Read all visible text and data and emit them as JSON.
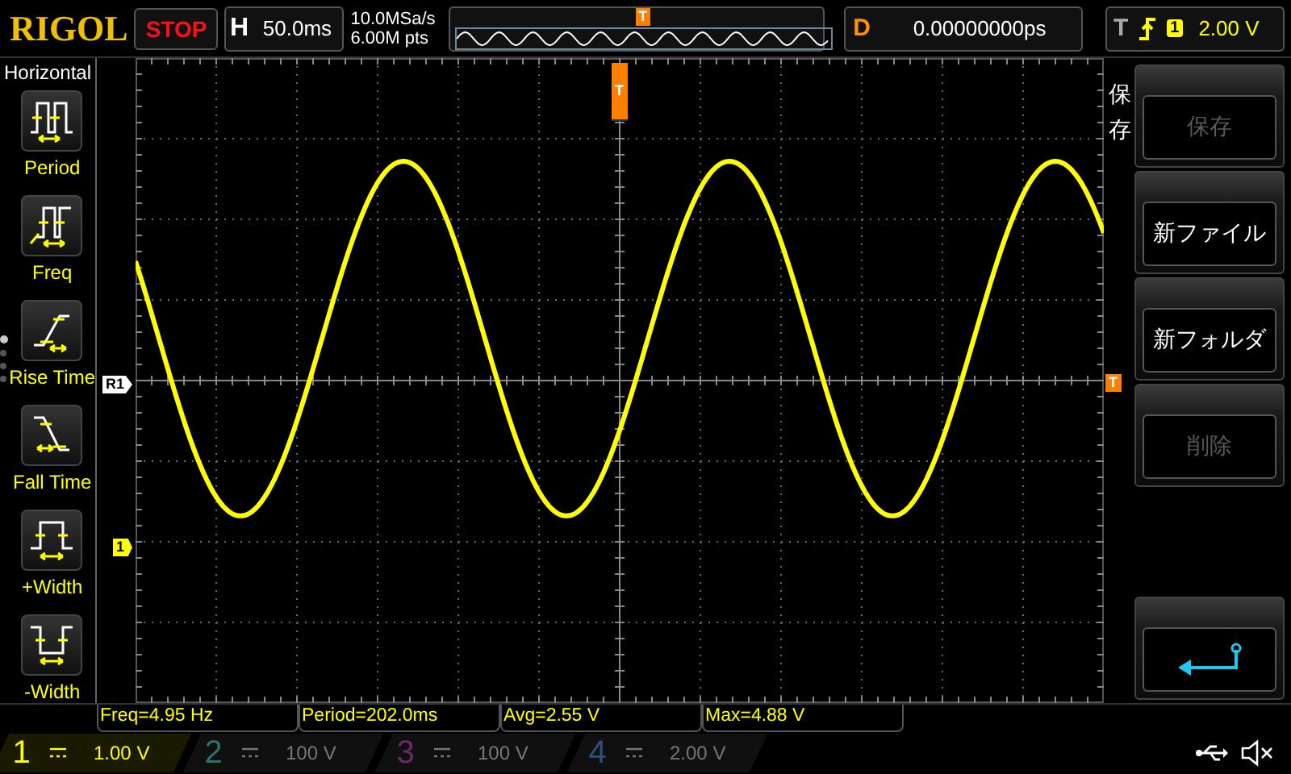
{
  "top_bar": {
    "logo": "RIGOL",
    "run_status": "STOP",
    "timebase": {
      "label": "H",
      "value": "50.0ms"
    },
    "sample_rate": "10.0MSa/s",
    "memory_depth": "6.00M pts",
    "overview_trigger": "T",
    "delay": {
      "label": "D",
      "value": "0.00000000ps"
    },
    "trigger": {
      "label": "T",
      "source": "1",
      "level": "2.00 V"
    }
  },
  "left_menu": {
    "title": "Horizontal",
    "items": [
      {
        "kind": "period",
        "label": "Period"
      },
      {
        "kind": "freq",
        "label": "Freq"
      },
      {
        "kind": "rise",
        "label": "Rise Time"
      },
      {
        "kind": "fall",
        "label": "Fall Time"
      },
      {
        "kind": "pwidth",
        "label": "+Width"
      },
      {
        "kind": "nwidth",
        "label": "-Width"
      }
    ],
    "pages": [
      {
        "selected": true
      },
      {
        "selected": false
      },
      {
        "selected": false
      },
      {
        "selected": false
      }
    ]
  },
  "markers": {
    "reference": "R1",
    "channel": "1",
    "trigger_position": "T",
    "trigger_level": "T"
  },
  "right_menu": {
    "title": "保存",
    "items": [
      {
        "kind": "text",
        "label": "保存",
        "disabled": true
      },
      {
        "kind": "text",
        "label": "新ファイル",
        "disabled": false
      },
      {
        "kind": "text",
        "label": "新フォルダ",
        "disabled": false
      },
      {
        "kind": "text",
        "label": "削除",
        "disabled": true
      },
      {
        "kind": "spacer"
      },
      {
        "kind": "back"
      }
    ]
  },
  "measurements": [
    "Freq=4.95 Hz",
    "Period=202.0ms",
    "Avg=2.55 V",
    "Max=4.88 V"
  ],
  "channels": [
    {
      "number": "1",
      "scale": "1.00 V",
      "enabled": true,
      "color": "#ffff00"
    },
    {
      "number": "2",
      "scale": "100 V",
      "enabled": false,
      "color": "#2f6f6f"
    },
    {
      "number": "3",
      "scale": "100 V",
      "enabled": false,
      "color": "#6a2a6a"
    },
    {
      "number": "4",
      "scale": "2.00 V",
      "enabled": false,
      "color": "#2f4f7f"
    }
  ]
}
